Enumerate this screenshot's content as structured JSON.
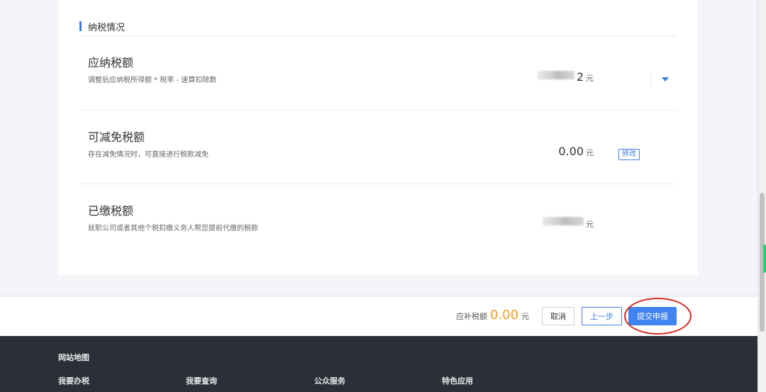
{
  "section": {
    "title": "纳税情况"
  },
  "rows": [
    {
      "title": "应纳税额",
      "desc": "调整后应纳税所得额 * 税率 - 速算扣除数",
      "value_visible_suffix": "2",
      "unit": "元"
    },
    {
      "title": "可减免税额",
      "desc": "存在减免情况时，可直接进行税款减免",
      "value": "0.00",
      "unit": "元",
      "action_label": "修改"
    },
    {
      "title": "已缴税额",
      "desc": "就职公司或者其他个税扣缴义务人帮您提前代缴的税款",
      "unit": "元"
    }
  ],
  "action_bar": {
    "due_label": "应补税额",
    "due_amount": "0.00",
    "due_unit": "元",
    "cancel_label": "取消",
    "prev_label": "上一步",
    "submit_label": "提交申报"
  },
  "footer": {
    "map_title": "网站地图",
    "columns": [
      "我要办税",
      "我要查询",
      "公众服务",
      "特色应用"
    ]
  },
  "colors": {
    "accent": "#3d7bea",
    "amount": "#f39a2b",
    "highlight": "#d82c20",
    "footer_bg": "#2a2f38"
  },
  "icons": {
    "dropdown": "chevron-down-icon"
  }
}
